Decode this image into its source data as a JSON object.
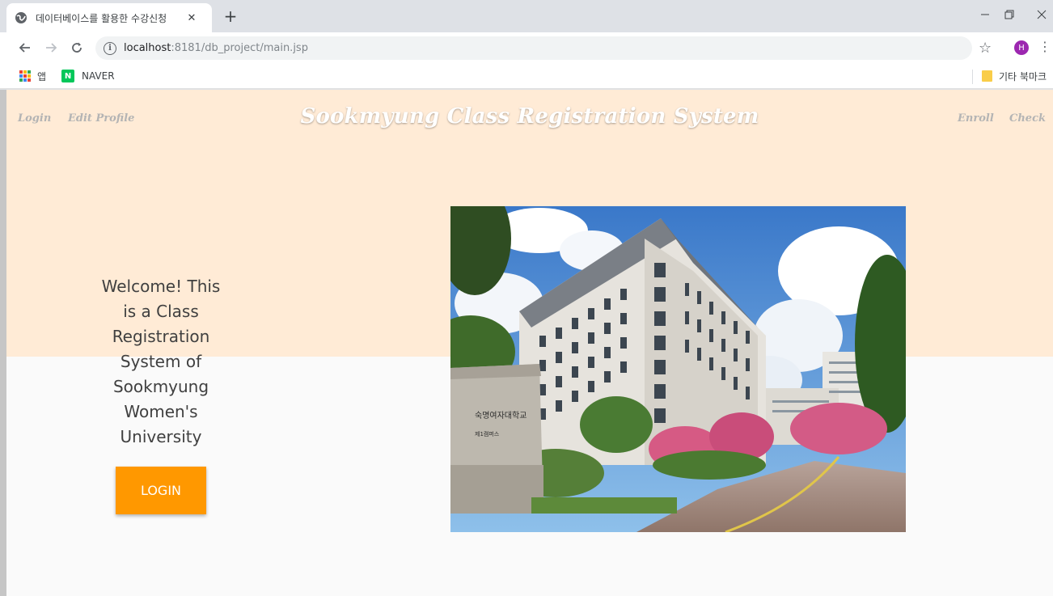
{
  "browser": {
    "tab_title": "데이터베이스를 활용한 수강신청",
    "tab_close": "✕",
    "new_tab": "+",
    "url_host": "localhost",
    "url_rest": ":8181/db_project/main.jsp",
    "profile_initial": "H",
    "bookmarks": [
      {
        "label": "앱",
        "icon": "apps-grid-icon"
      },
      {
        "label": "NAVER",
        "icon": "naver-icon"
      },
      {
        "label": "기타 북마크",
        "icon": "folder-icon"
      }
    ],
    "colors": {
      "profile": "#9c27b0",
      "naver": "#03c75a",
      "folder": "#f9cd49"
    }
  },
  "site": {
    "title": "Sookmyung Class Registration System",
    "nav_left": [
      "Login",
      "Edit Profile"
    ],
    "nav_right": [
      "Enroll",
      "Check"
    ],
    "welcome_lines": [
      "Welcome! This",
      "is a Class",
      "Registration",
      "System of",
      "Sookmyung",
      "Women's",
      "University"
    ],
    "login_button": "LOGIN",
    "photo_sign_text": "숙명여자대학교",
    "photo_sign_sub": "제1캠퍼스",
    "colors": {
      "hero_band": "#ffebd6",
      "login_button": "#ff9800",
      "page_bg": "#fafafa"
    }
  }
}
